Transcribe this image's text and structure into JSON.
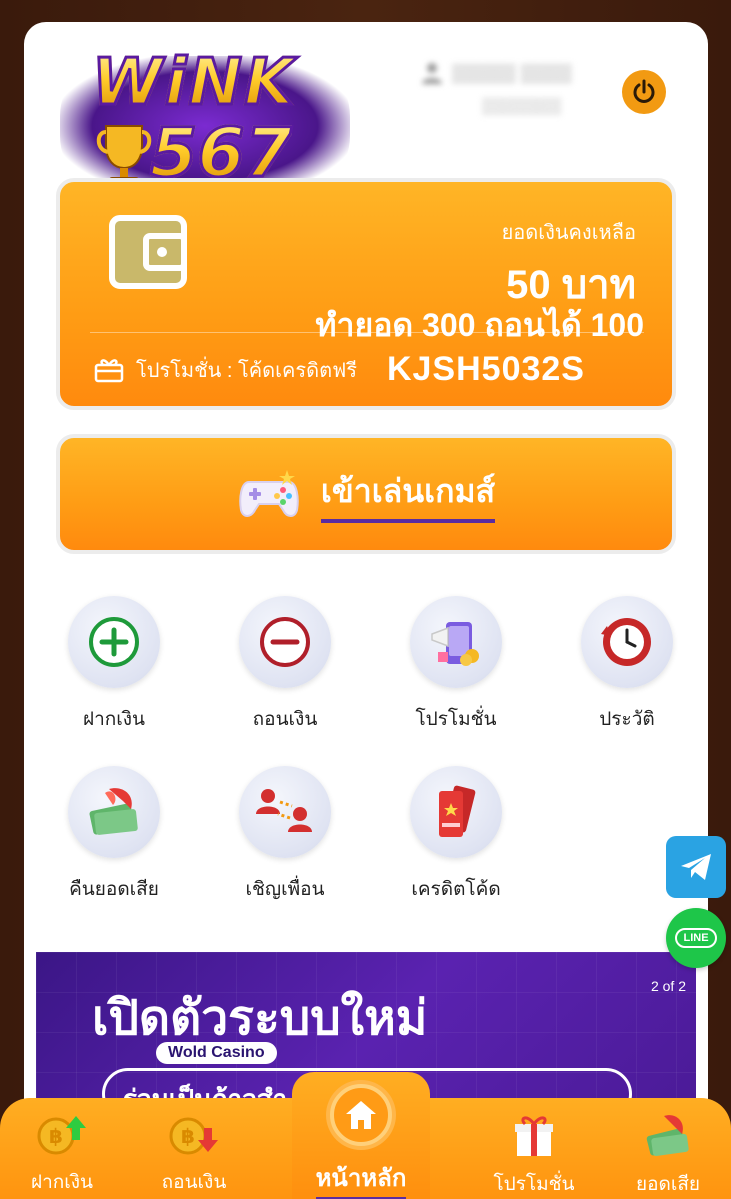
{
  "brand": {
    "logo_word": "WiNK",
    "logo_number": "567"
  },
  "balance": {
    "label": "ยอดเงินคงเหลือ",
    "amount": "50 บาท",
    "turnover": "ทำยอด 300 ถอนได้ 100",
    "promo_label": "โปรโมชั่น : โค้ดเครดิตฟรี",
    "promo_code": "KJSH5032S"
  },
  "play": {
    "label": "เข้าเล่นเกมส์"
  },
  "menu": {
    "items": [
      {
        "label": "ฝากเงิน",
        "icon": "plus-circle-icon"
      },
      {
        "label": "ถอนเงิน",
        "icon": "minus-circle-icon"
      },
      {
        "label": "โปรโมชั่น",
        "icon": "megaphone-phone-icon"
      },
      {
        "label": "ประวัติ",
        "icon": "history-clock-icon"
      },
      {
        "label": "คืนยอดเสีย",
        "icon": "money-cashback-icon"
      },
      {
        "label": "เชิญเพื่อน",
        "icon": "invite-friends-icon"
      },
      {
        "label": "เครดิตโค้ด",
        "icon": "ticket-icon"
      }
    ]
  },
  "social": {
    "line_label": "LINE"
  },
  "banner": {
    "title": "เปิดตัวระบบใหม่",
    "counter": "2 of 2",
    "tag": "Wold Casino",
    "subtitle": "ร่วมเป็นก้าวสำ..."
  },
  "bottom_nav": {
    "items": [
      {
        "label": "ฝากเงิน"
      },
      {
        "label": "ถอนเงิน"
      },
      {
        "label": "หน้าหลัก"
      },
      {
        "label": "โปรโมชั่น"
      },
      {
        "label": "ยอดเสีย"
      }
    ]
  },
  "colors": {
    "accent": "#ff9c14",
    "banner": "#4a1a96",
    "telegram": "#2aa3e3",
    "line": "#1ec649"
  }
}
